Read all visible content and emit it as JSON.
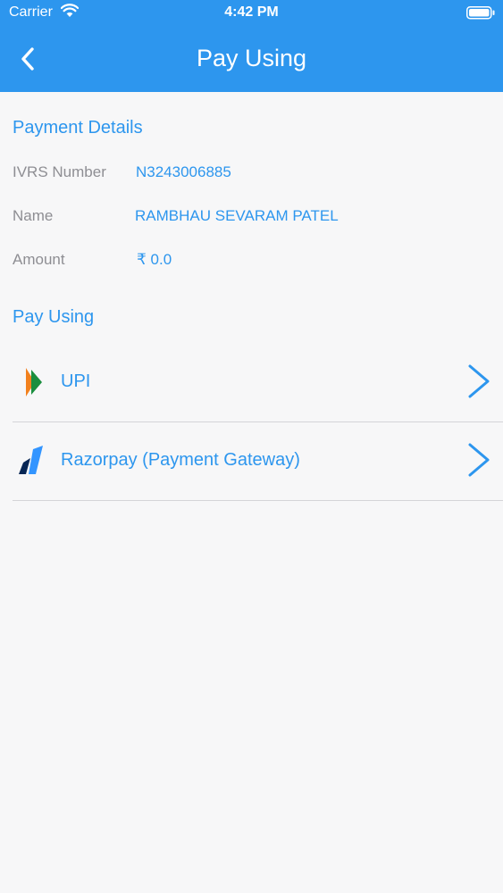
{
  "status_bar": {
    "carrier": "Carrier",
    "time": "4:42 PM"
  },
  "header": {
    "title": "Pay Using",
    "back_icon": "chevron-left-icon"
  },
  "payment_details": {
    "title": "Payment Details",
    "rows": [
      {
        "label": "IVRS Number",
        "value": "N3243006885"
      },
      {
        "label": "Name",
        "value": "RAMBHAU SEVARAM PATEL"
      },
      {
        "label": "Amount",
        "value": "₹ 0.0"
      }
    ]
  },
  "pay_using": {
    "title": "Pay Using",
    "options": [
      {
        "label": "UPI",
        "icon": "upi-logo-icon"
      },
      {
        "label": "Razorpay (Payment Gateway)",
        "icon": "razorpay-logo-icon"
      }
    ]
  },
  "colors": {
    "accent": "#2D96EE",
    "label_gray": "#8E8E93",
    "background": "#F7F7F8"
  }
}
